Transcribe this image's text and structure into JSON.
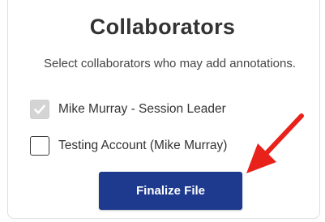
{
  "dialog": {
    "title": "Collaborators",
    "subtitle": "Select collaborators who may add annotations."
  },
  "collaborators": [
    {
      "label": "Mike Murray - Session Leader",
      "checked": true,
      "disabled": true
    },
    {
      "label": "Testing Account (Mike Murray)",
      "checked": false,
      "disabled": false
    }
  ],
  "actions": {
    "finalize_label": "Finalize File"
  },
  "colors": {
    "button_bg": "#1d3a8f",
    "annotation_arrow": "#e8221b",
    "checkbox_disabled": "#d4d4d4"
  },
  "icons": {
    "checked": "checkmark-icon",
    "annotation": "red-arrow-icon"
  }
}
